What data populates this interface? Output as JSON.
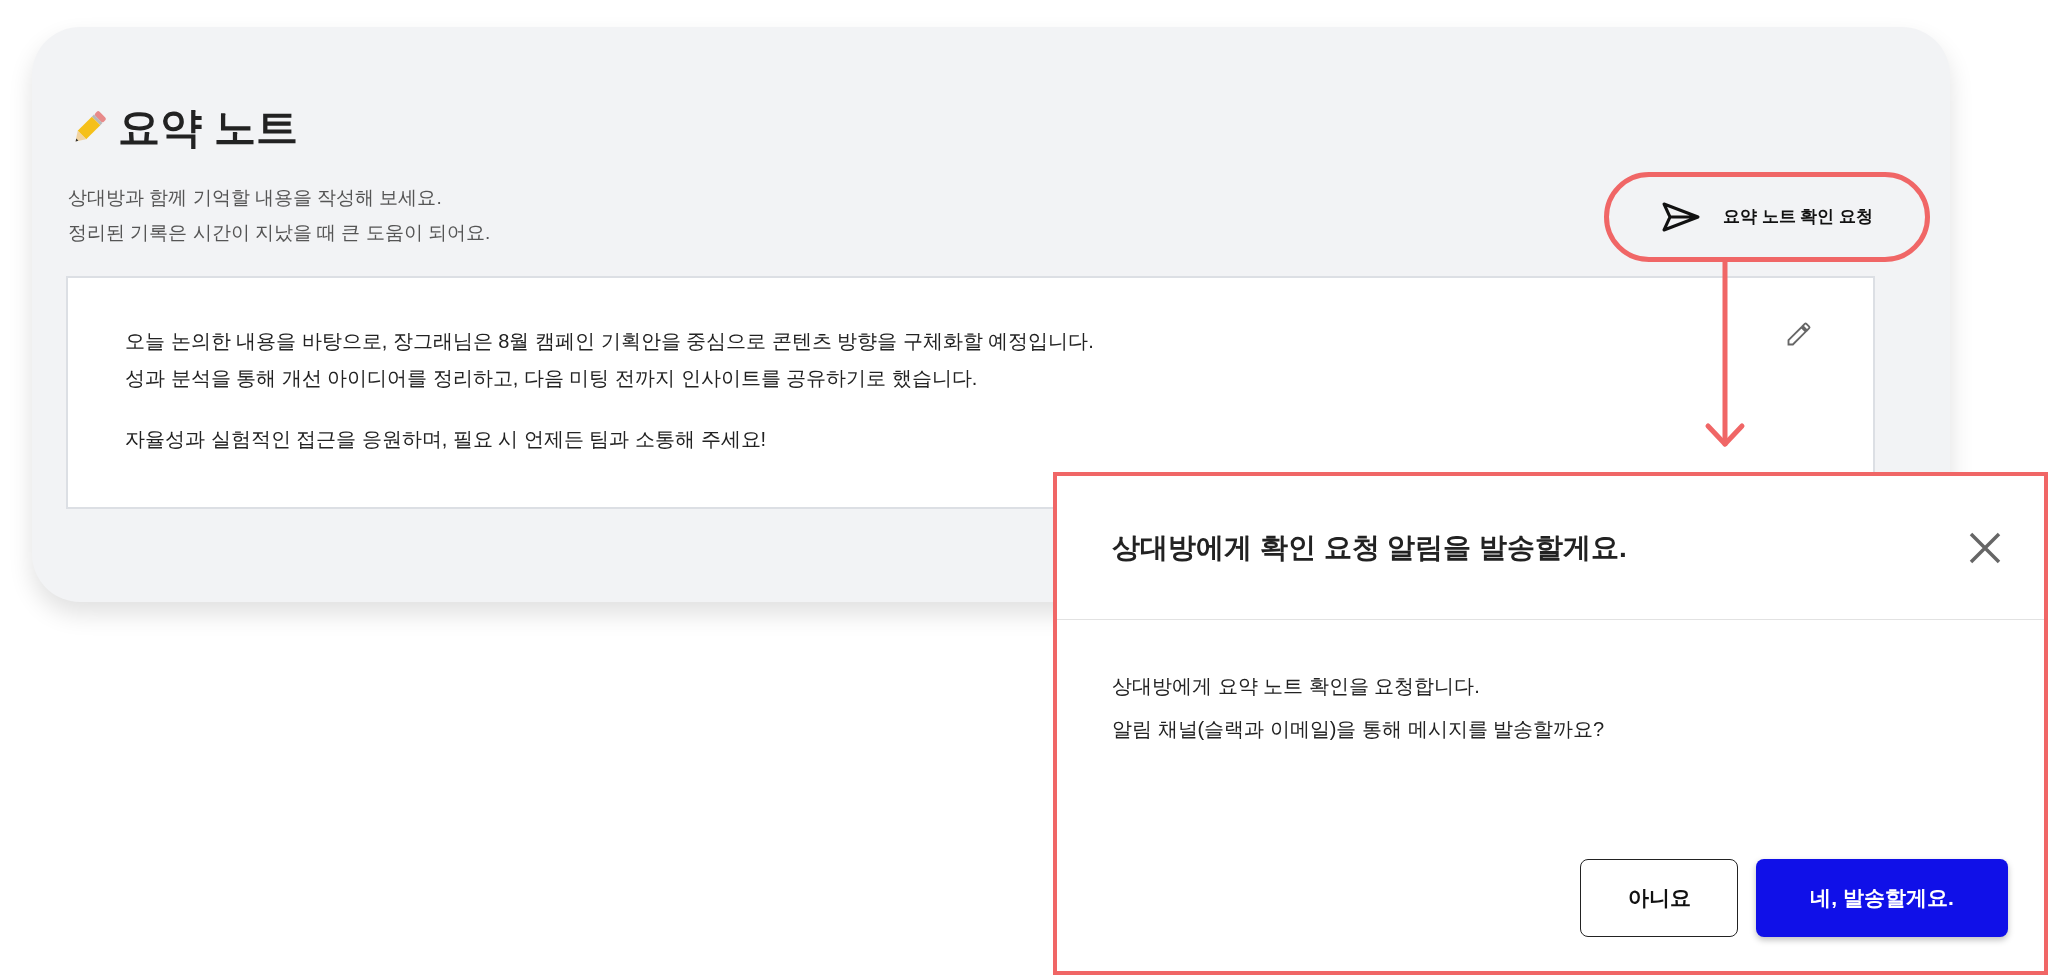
{
  "note": {
    "title": "요약 노트",
    "description": [
      "상대방과 함께 기억할 내용을 작성해 보세요.",
      "정리된 기록은 시간이 지났을 때 큰 도움이 되어요."
    ],
    "request_button": "요약 노트 확인 요청",
    "paragraphs": [
      {
        "lines": [
          "오늘 논의한 내용을 바탕으로, 장그래님은 8월 캠페인 기획안을 중심으로 콘텐츠 방향을 구체화할 예정입니다.",
          "성과 분석을 통해 개선 아이디어를 정리하고, 다음 미팅 전까지 인사이트를 공유하기로 했습니다."
        ]
      },
      {
        "lines": [
          "자율성과 실험적인 접근을 응원하며, 필요 시 언제든 팀과 소통해 주세요!"
        ]
      }
    ]
  },
  "dialog": {
    "title": "상대방에게 확인 요청 알림을 발송할게요.",
    "message": [
      "상대방에게 요약 노트 확인을 요청합니다.",
      "알림 채널(슬랙과 이메일)을 통해 메시지를 발송할까요?"
    ],
    "buttons": [
      {
        "label": "아니요",
        "kind": "secondary"
      },
      {
        "label": "네, 발송할게요.",
        "kind": "primary"
      }
    ]
  }
}
